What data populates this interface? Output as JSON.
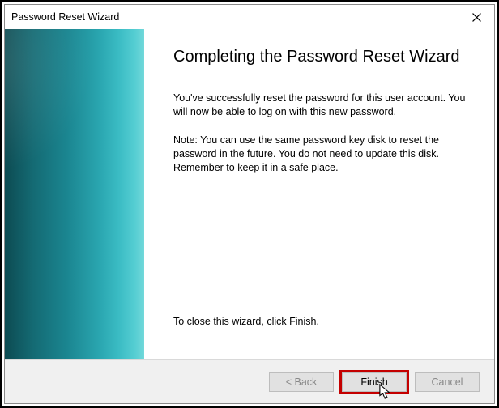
{
  "window": {
    "title": "Password Reset Wizard"
  },
  "main": {
    "heading": "Completing the Password Reset Wizard",
    "para1": "You've successfully reset the password for this user account. You will now be able to log on with this new password.",
    "para2": "Note: You can use the same password key disk to reset the password in the future. You do not need to update this disk. Remember to keep it in a safe place.",
    "closing": "To close this wizard, click Finish."
  },
  "buttons": {
    "back": "< Back",
    "finish": "Finish",
    "cancel": "Cancel"
  }
}
